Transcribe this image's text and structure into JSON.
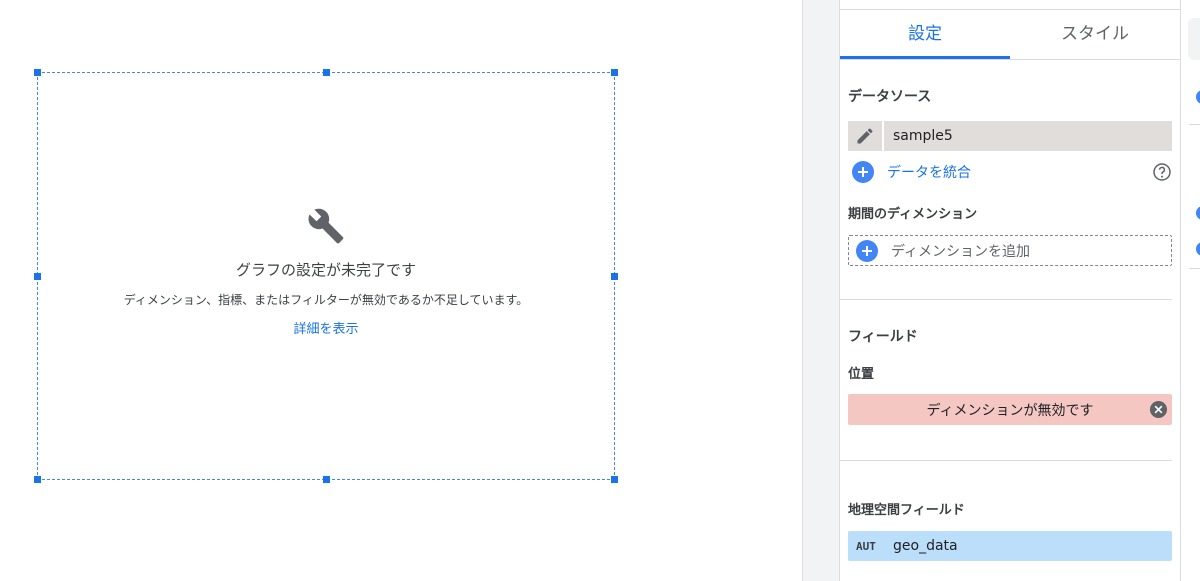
{
  "chart": {
    "title": "グラフの設定が未完了です",
    "message": "ディメンション、指標、またはフィルターが無効であるか不足しています。",
    "link": "詳細を表示"
  },
  "tabs": [
    {
      "label": "設定",
      "active": true
    },
    {
      "label": "スタイル",
      "active": false
    }
  ],
  "data_source": {
    "title": "データソース",
    "name": "sample5",
    "blend_label": "データを統合"
  },
  "date_dimension": {
    "label": "期間のディメンション",
    "add_placeholder": "ディメンションを追加"
  },
  "fields": {
    "title": "フィールド",
    "location_label": "位置",
    "location_error": "ディメンションが無効です",
    "geo_label": "地理空間フィールド",
    "geo_type": "AUT",
    "geo_field": "geo_data"
  },
  "colors": {
    "accent": "#1a73e8",
    "error_chip": "#f4c7c3",
    "geo_chip": "#bbdefb",
    "data_source_chip": "#e0ddda"
  },
  "icons": [
    "wrench-icon",
    "pencil-icon",
    "plus-icon",
    "help-icon",
    "close-circle-icon"
  ]
}
